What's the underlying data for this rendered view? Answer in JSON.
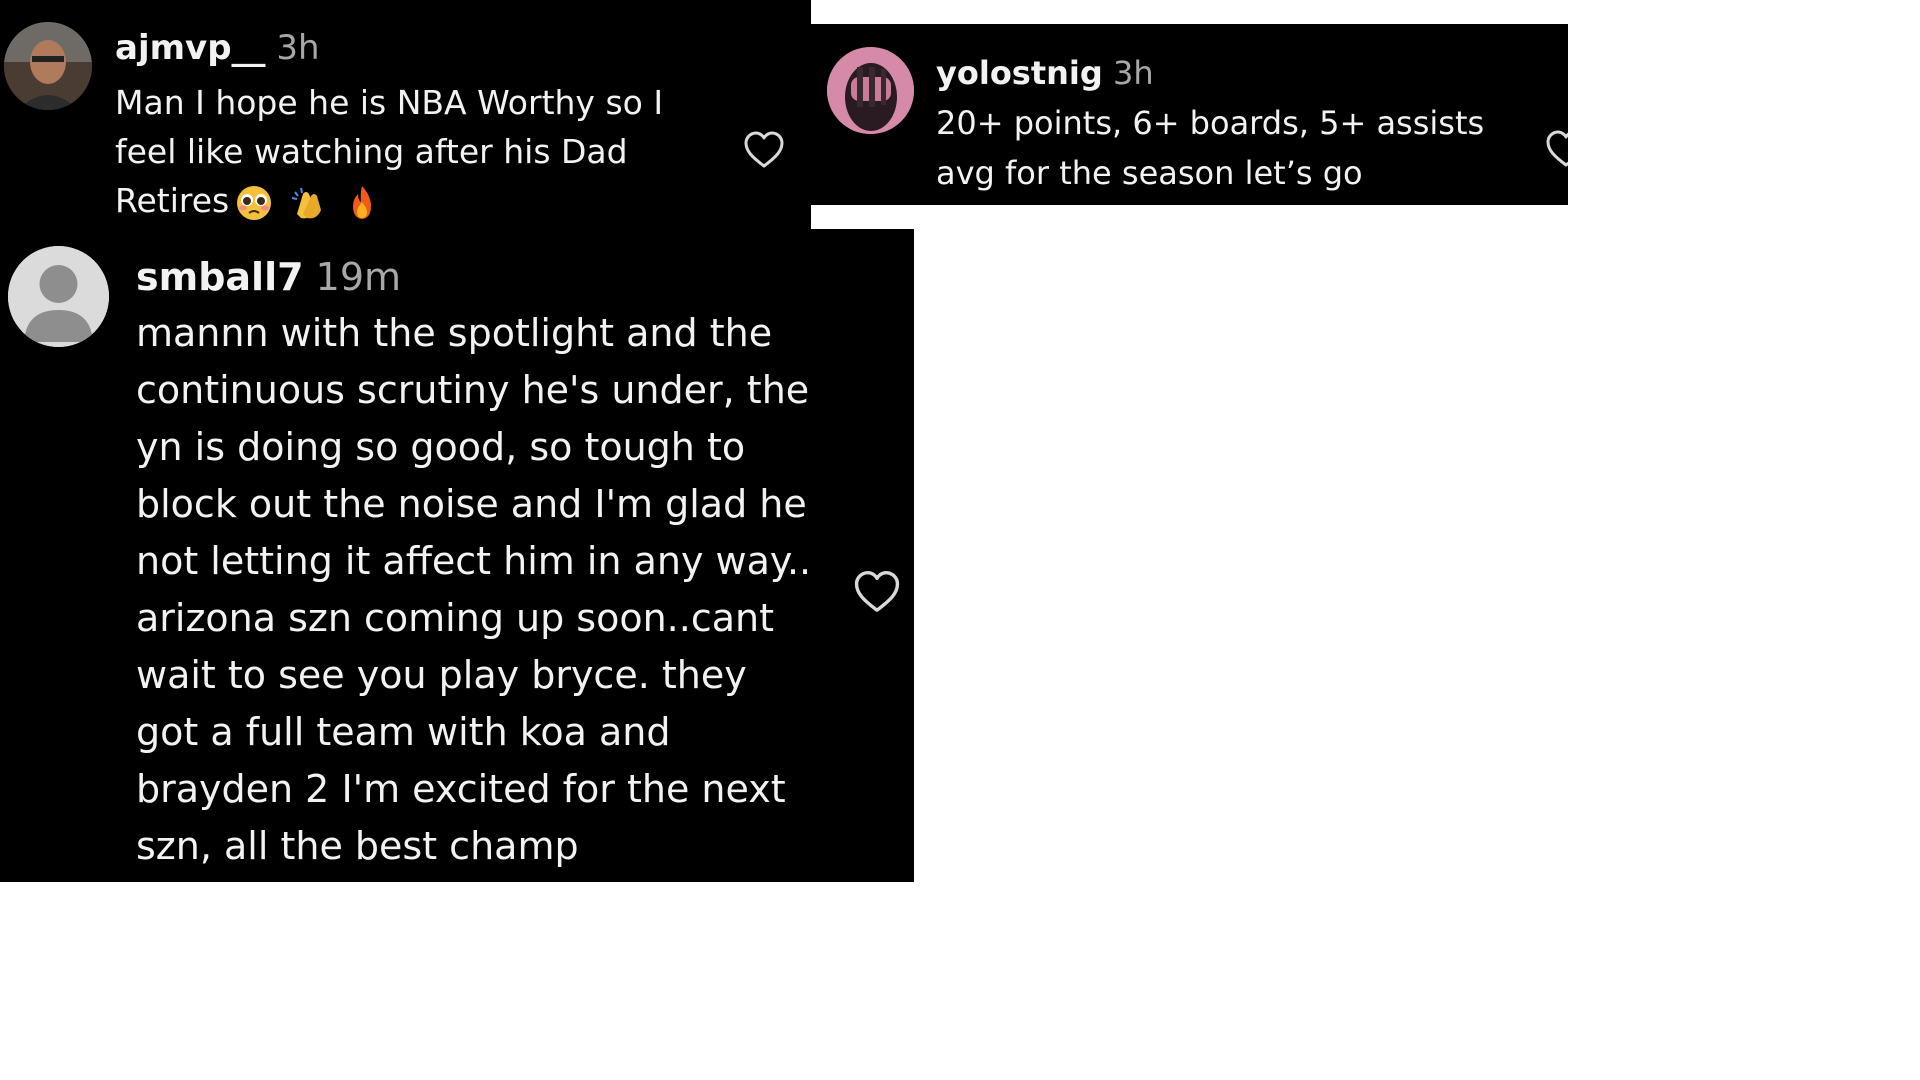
{
  "comments": [
    {
      "username": "ajmvp__",
      "time": "3h",
      "lines": [
        "Man I hope he is NBA Worthy so I",
        "feel like watching after his Dad",
        "Retires"
      ],
      "emojis": [
        "pleading-face-icon",
        "clapping-hands-icon",
        "fire-icon"
      ],
      "avatar": "profile-photo",
      "heart_icon": "heart-outline-icon"
    },
    {
      "username": "yolostnig",
      "time": "3h",
      "lines": [
        "20+ points, 6+ boards, 5+ assists",
        "avg for the season let’s go"
      ],
      "avatar": "profile-photo-pink",
      "heart_icon": "heart-outline-icon"
    },
    {
      "username": "smball7",
      "time": "19m",
      "lines": [
        "mannn with the spotlight and the",
        "continuous scrutiny he's under, the",
        "yn is doing so good, so tough to",
        "block out the noise and I'm glad he",
        "not letting it affect him in any way..",
        "arizona szn coming up soon..cant",
        "wait to see you play bryce. they",
        "got a full team with koa and",
        "brayden 2 I'm excited for the next",
        "szn, all the best champ"
      ],
      "avatar": "default-avatar",
      "heart_icon": "heart-outline-icon"
    }
  ],
  "colors": {
    "background": "#000000",
    "text": "#f2f2f2",
    "muted": "#a8a8a8",
    "page": "#ffffff"
  }
}
